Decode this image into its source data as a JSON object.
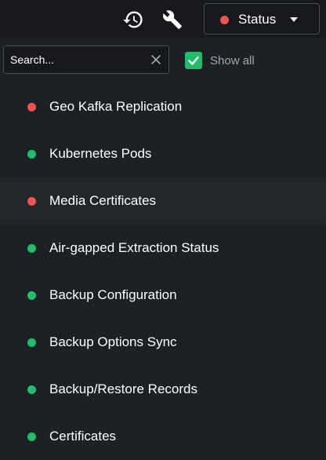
{
  "toolbar": {
    "history_icon": "history-icon",
    "settings_icon": "wrench-icon",
    "status_label": "Status",
    "status_color": "#f2534f"
  },
  "filter": {
    "search_placeholder": "Search...",
    "search_value": "",
    "show_all_label": "Show all",
    "show_all_checked": true,
    "checkbox_color": "#1fbf6a"
  },
  "colors": {
    "ok": "#1fbf6a",
    "error": "#f2534f"
  },
  "items": [
    {
      "label": "Geo Kafka Replication",
      "status": "error"
    },
    {
      "label": "Kubernetes Pods",
      "status": "ok"
    },
    {
      "label": "Media Certificates",
      "status": "error"
    },
    {
      "label": "Air-gapped Extraction Status",
      "status": "ok"
    },
    {
      "label": "Backup Configuration",
      "status": "ok"
    },
    {
      "label": "Backup Options Sync",
      "status": "ok"
    },
    {
      "label": "Backup/Restore Records",
      "status": "ok"
    },
    {
      "label": "Certificates",
      "status": "ok"
    }
  ]
}
